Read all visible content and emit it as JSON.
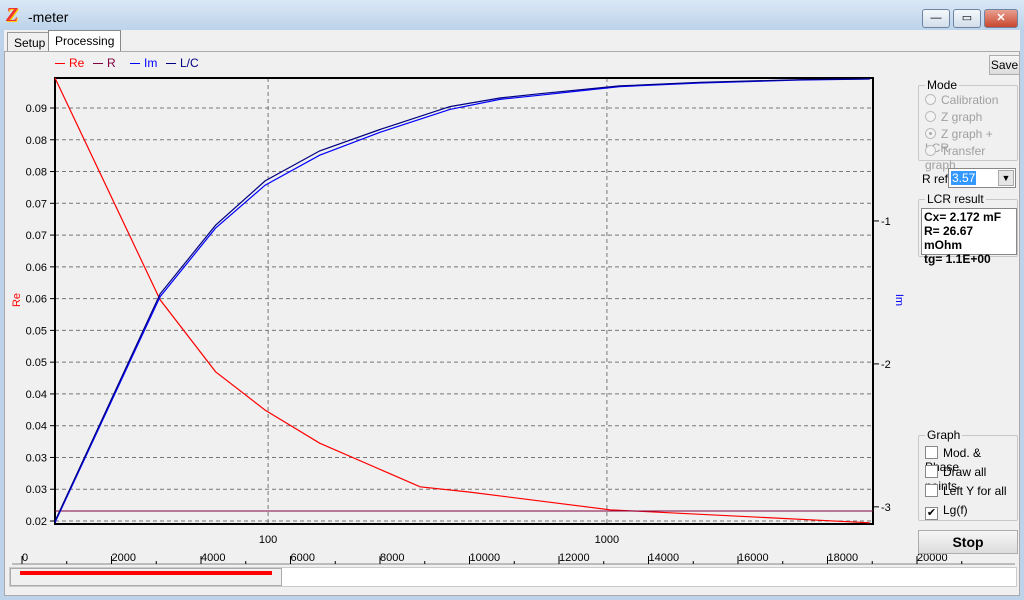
{
  "window": {
    "title": "-meter",
    "icon": "z-logo-icon",
    "minimize": "—",
    "maximize": "▭",
    "close": "✕"
  },
  "tabs": [
    {
      "label": "Setup"
    },
    {
      "label": "Processing",
      "active": true
    }
  ],
  "toolbar": {
    "save_label": "Save"
  },
  "mode": {
    "label": "Mode",
    "options": [
      {
        "label": "Calibration",
        "selected": false
      },
      {
        "label": "Z graph",
        "selected": false
      },
      {
        "label": "Z graph + LCR",
        "selected": true
      },
      {
        "label": "Transfer graph",
        "selected": false
      }
    ]
  },
  "rref": {
    "label": "R ref",
    "value": "3.57"
  },
  "lcr": {
    "label": "LCR result",
    "lines": [
      "Cx= 2.172 mF",
      "R= 26.67 mOhm",
      "tg= 1.1E+00"
    ]
  },
  "graph": {
    "label": "Graph",
    "options": [
      {
        "label": "Mod. & Phase",
        "checked": false
      },
      {
        "label": "Draw all points",
        "checked": false
      },
      {
        "label": "Left Y for all",
        "checked": false
      },
      {
        "label": "Lg(f)",
        "checked": true
      }
    ]
  },
  "stop_label": "Stop",
  "progress": {
    "scale_ticks": [
      "0",
      "2000",
      "4000",
      "6000",
      "8000",
      "10000",
      "12000",
      "14000",
      "16000",
      "18000",
      "20000"
    ],
    "value": 5800,
    "max": 20000,
    "color": "#ff0000"
  },
  "chart_data": {
    "type": "line",
    "legend": [
      {
        "name": "Re",
        "color": "#ff0000"
      },
      {
        "name": "R",
        "color": "#800040"
      },
      {
        "name": "Im",
        "color": "#0000ff"
      },
      {
        "name": "L/C",
        "color": "#000080"
      }
    ],
    "legend_placement": "top-left",
    "ylabel_left": "Re",
    "ylabel_right": "Im",
    "x_scale": "log",
    "xlim": [
      23.5,
      6100
    ],
    "x_ticks": [
      "100",
      "1000"
    ],
    "ylim_left": [
      0.0195,
      0.0951
    ],
    "y_left_ticks": [
      "0.09",
      "0.08",
      "0.08",
      "0.07",
      "0.07",
      "0.06",
      "0.06",
      "0.05",
      "0.05",
      "0.04",
      "0.04",
      "0.03",
      "0.03",
      "0.02"
    ],
    "ylim_right": [
      -3.12,
      0
    ],
    "y_right_ticks": [
      "-1",
      "-2",
      "-3"
    ],
    "grid": true,
    "series": [
      {
        "name": "Re",
        "axis": "left",
        "color": "#ff0000",
        "x": [
          23.5,
          48,
          70,
          98,
          142,
          281,
          394,
          1020,
          5970
        ],
        "y": [
          0.0951,
          0.0575,
          0.0453,
          0.0388,
          0.0332,
          0.0258,
          0.0249,
          0.0219,
          0.0197
        ]
      },
      {
        "name": "R",
        "axis": "left",
        "color": "#800040",
        "x": [
          23.5,
          6100
        ],
        "y": [
          0.0217,
          0.0217
        ]
      },
      {
        "name": "Im",
        "axis": "right",
        "color": "#0000ff",
        "x": [
          23.5,
          48,
          70,
          98,
          142,
          214,
          344,
          483,
          635,
          1090,
          1880,
          3700,
          5970
        ],
        "y": [
          -3.11,
          -1.53,
          -1.05,
          -0.75,
          -0.54,
          -0.38,
          -0.22,
          -0.15,
          -0.12,
          -0.06,
          -0.035,
          -0.014,
          -0.007
        ]
      },
      {
        "name": "L/C",
        "axis": "right",
        "color": "#000080",
        "x": [
          23.5,
          48,
          70,
          98,
          142,
          214,
          344,
          483,
          635,
          1090,
          1880,
          3700,
          5970
        ],
        "y": [
          -3.1,
          -1.51,
          -1.03,
          -0.72,
          -0.51,
          -0.36,
          -0.2,
          -0.14,
          -0.11,
          -0.055,
          -0.03,
          -0.012,
          -0.006
        ]
      }
    ]
  }
}
